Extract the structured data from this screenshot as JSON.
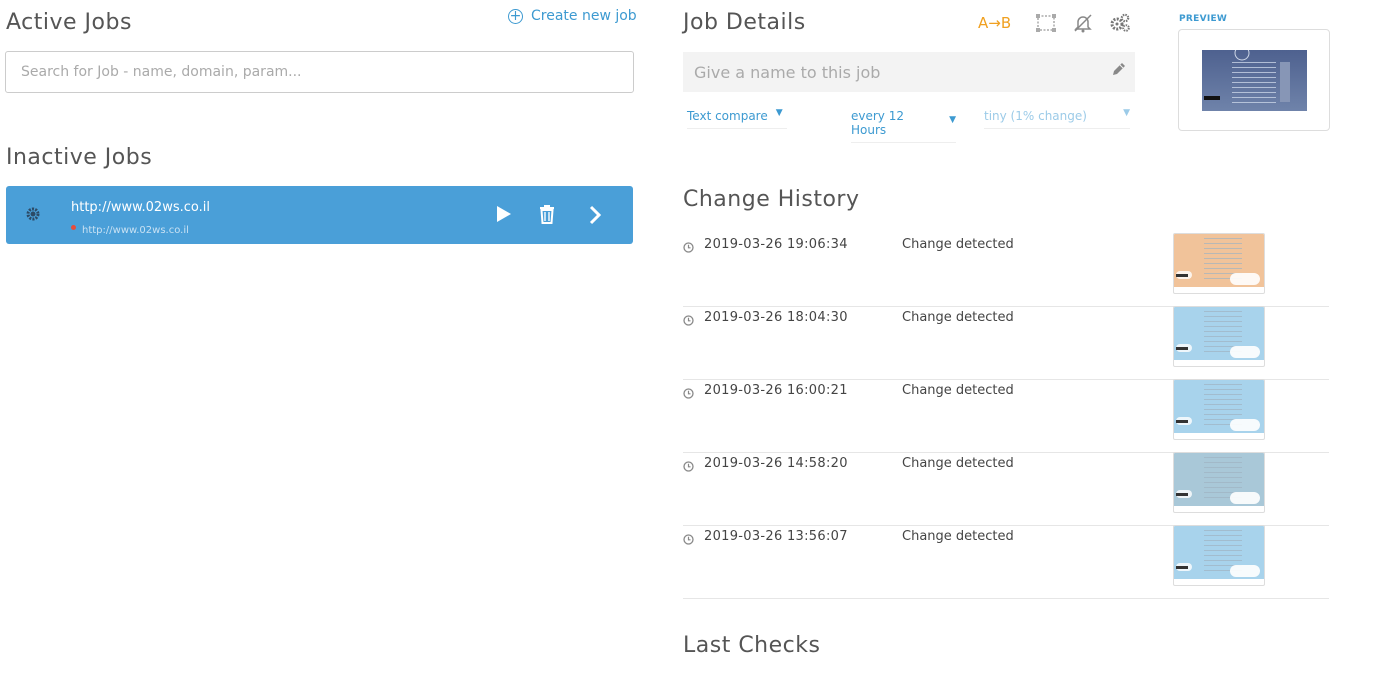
{
  "left": {
    "active_title": "Active Jobs",
    "create_label": "Create new job",
    "search_placeholder": "Search for Job - name, domain, param...",
    "inactive_title": "Inactive Jobs",
    "inactive_jobs": [
      {
        "url": "http://www.02ws.co.il",
        "sub_url": "http://www.02ws.co.il"
      }
    ]
  },
  "details": {
    "title": "Job Details",
    "ab_label": "A→B",
    "name_placeholder": "Give a name to this job",
    "compare_type": "Text compare",
    "frequency": "every 12 Hours",
    "sensitivity": "tiny (1% change)",
    "preview_label": "PREVIEW"
  },
  "history": {
    "title": "Change History",
    "rows": [
      {
        "timestamp": "2019-03-26 19:06:34",
        "status": "Change detected",
        "thumb_color": "#f1c39a"
      },
      {
        "timestamp": "2019-03-26 18:04:30",
        "status": "Change detected",
        "thumb_color": "#a8d3ec"
      },
      {
        "timestamp": "2019-03-26 16:00:21",
        "status": "Change detected",
        "thumb_color": "#a8d3ec"
      },
      {
        "timestamp": "2019-03-26 14:58:20",
        "status": "Change detected",
        "thumb_color": "#a9c8d8"
      },
      {
        "timestamp": "2019-03-26 13:56:07",
        "status": "Change detected",
        "thumb_color": "#a8d3ec"
      }
    ]
  },
  "last_checks_title": "Last Checks",
  "colors": {
    "accent": "#3d9ad1",
    "card": "#4a9fd8",
    "ab": "#f0a020"
  }
}
